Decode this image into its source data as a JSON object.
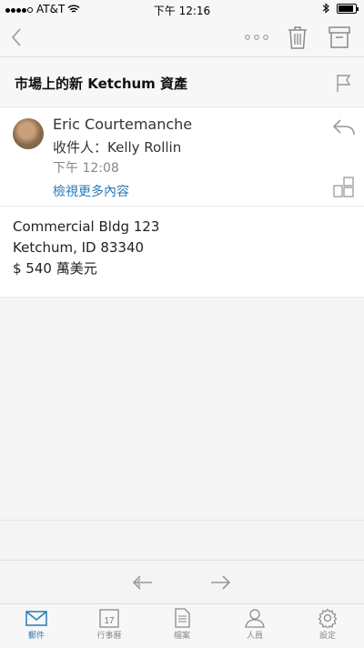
{
  "status": {
    "carrier": "AT&T",
    "time": "下午 12:16"
  },
  "subject": "市場上的新 Ketchum 資產",
  "message": {
    "sender": "Eric Courtemanche",
    "to": "收件人：Kelly Rollin",
    "time": "下午 12:08",
    "more_link": "檢視更多內容",
    "body_lines": [
      "Commercial Bldg 123",
      "Ketchum, ID 83340",
      "$ 540 萬美元"
    ]
  },
  "tabs": [
    {
      "label": "郵件",
      "icon": "mail-icon",
      "active": true
    },
    {
      "label": "行事曆",
      "icon": "calendar-icon",
      "day": "17"
    },
    {
      "label": "檔案",
      "icon": "files-icon"
    },
    {
      "label": "人員",
      "icon": "people-icon"
    },
    {
      "label": "設定",
      "icon": "settings-icon"
    }
  ],
  "colors": {
    "accent": "#2a7ab8",
    "icon_gray": "#8a8a8a"
  }
}
